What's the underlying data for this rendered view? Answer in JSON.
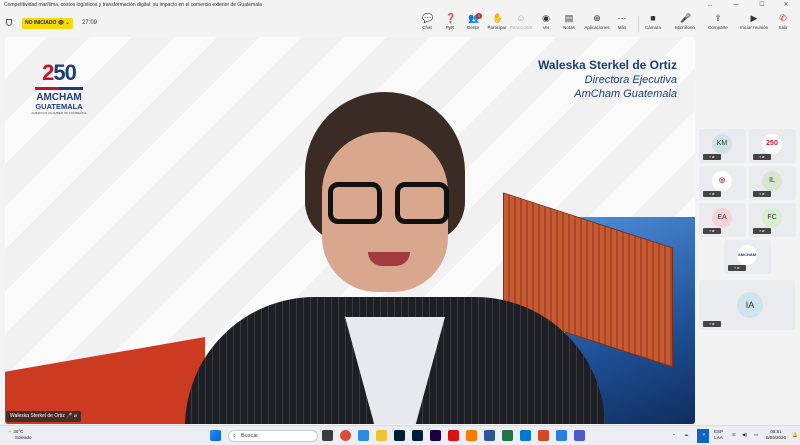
{
  "window": {
    "title": "Competitividad marítima, costos logísticos y transformación digital: su impacto en el comercio exterior de Guatemala",
    "controls": [
      "...",
      "—",
      "☐",
      "✕"
    ]
  },
  "meeting_bar": {
    "status_badge": "NO INICIADO",
    "timer": "27:09",
    "buttons": [
      {
        "icon": "chat-icon",
        "glyph": "💬",
        "label": "Chat"
      },
      {
        "icon": "qa-icon",
        "glyph": "❓",
        "label": "PyR"
      },
      {
        "icon": "people-icon",
        "glyph": "👥",
        "label": "Gente"
      },
      {
        "icon": "raise-hand-icon",
        "glyph": "✋",
        "label": "Participar"
      },
      {
        "icon": "reactions-icon",
        "glyph": "☺",
        "label": "Reaccionar"
      },
      {
        "icon": "view-icon",
        "glyph": "◉",
        "label": "Ver"
      },
      {
        "icon": "notes-icon",
        "glyph": "▤",
        "label": "Notas"
      },
      {
        "icon": "apps-icon",
        "glyph": "⊕",
        "label": "Aplicaciones"
      },
      {
        "icon": "more-icon",
        "glyph": "⋯",
        "label": "Más"
      },
      {
        "icon": "camera-icon",
        "glyph": "■",
        "label": "Cámara"
      },
      {
        "icon": "mic-icon",
        "glyph": "🎤",
        "label": "Micrófono"
      },
      {
        "icon": "share-icon",
        "glyph": "⇪",
        "label": "Comparte"
      },
      {
        "icon": "start-meeting-icon",
        "glyph": "▶",
        "label": "Iniciar reunión"
      }
    ],
    "leave_label": "Salir",
    "people_badge": "1"
  },
  "speaker": {
    "slide_name": "Waleska Sterkel de Ortiz",
    "slide_role": "Directora Ejecutiva",
    "slide_org": "AmCham Guatemala",
    "name_tag": "Waleska Sterkel de Ortiz"
  },
  "logo": {
    "number_a": "2",
    "number_b": "50",
    "brand": "AMCHAM",
    "country": "GUATEMALA",
    "tagline": "AMERICAN CHAMBER OF COMMERCE"
  },
  "participants": [
    {
      "initials": "KM",
      "color": "#cfe3e6"
    },
    {
      "initials": "",
      "color": "#ffffff"
    },
    {
      "initials": "",
      "color": "#ffffff"
    },
    {
      "initials": "IL",
      "color": "#d5e8cf"
    },
    {
      "initials": "EA",
      "color": "#f6d3d8"
    },
    {
      "initials": "FC",
      "color": "#d9eecd"
    },
    {
      "initials": "",
      "color": "#ffffff"
    },
    {
      "initials": "IA",
      "color": "#cfe5ec"
    }
  ],
  "taskbar": {
    "weather_temp": "30°C",
    "weather_text": "Soleado",
    "search_placeholder": "Buscar",
    "lang_top": "ESP",
    "lang_bottom": "LAA",
    "time": "08:51",
    "date": "6/09/2026"
  }
}
